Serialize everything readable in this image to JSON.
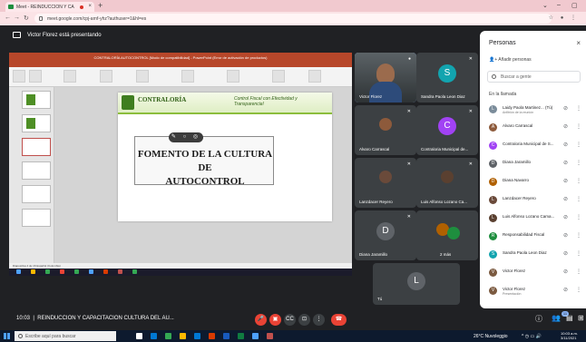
{
  "browser": {
    "tab_title": "Meet - REINDUCCION Y CA",
    "new_tab": "+",
    "url": "meet.google.com/cpj-arnf-yhz?authuser=1&hl=es",
    "win_min": "⌄",
    "win_max": "–",
    "win_close": "▢"
  },
  "presenting": {
    "text": "Victor Florez está presentando"
  },
  "powerpoint": {
    "title": "CONTRALORÍA AUTOCONTROL [Modo de compatibilidad] - PowerPoint (Error de activación de productos)",
    "status": "Diapositiva 4 de 16   Español (Colombia)",
    "slide": {
      "org": "CONTRALORÍA",
      "slogan": "Control Fiscal con Efectividad y Transparencia!",
      "headline_line1": "FOMENTO DE LA CULTURA DE",
      "headline_line2": "AUTOCONTROL"
    }
  },
  "tiles": [
    {
      "name": "Victor Florez",
      "type": "camera"
    },
    {
      "name": "Sandra Paola Leon Diaz",
      "type": "letter",
      "letter": "S",
      "color": "#12a4af"
    },
    {
      "name": "Alvaro Carrascal",
      "type": "photo"
    },
    {
      "name": "Contraloria Municipal de...",
      "type": "letter",
      "letter": "C",
      "color": "#a142f4"
    },
    {
      "name": "Lanzdacer Reyero",
      "type": "photo"
    },
    {
      "name": "Luis Alfonso Lozano Ca...",
      "type": "photo"
    },
    {
      "name": "Diana Jaramillo",
      "type": "letter",
      "letter": "D",
      "color": "#5f6368"
    },
    {
      "name": "2 más",
      "type": "photo"
    },
    {
      "name": "Tú",
      "type": "letter",
      "letter": "L",
      "color": "#5f6368"
    }
  ],
  "people_panel": {
    "title": "Personas",
    "add_people": "Añadir personas",
    "search_placeholder": "Buscar a gente",
    "section": "En la llamada",
    "rows": [
      {
        "name": "Laidy Paola Martinez... (Tú)",
        "sub": "Anfitrión de la reunión",
        "letter": "L",
        "color": "#7b8c9a"
      },
      {
        "name": "Alvaro Carrascal",
        "letter": "A",
        "color": "#8d5a3b"
      },
      {
        "name": "Contraloria Municipal de S...",
        "letter": "C",
        "color": "#a142f4"
      },
      {
        "name": "Diana Jaramillo",
        "letter": "D",
        "color": "#5f6368"
      },
      {
        "name": "Diana Navarro",
        "letter": "D",
        "color": "#b06000"
      },
      {
        "name": "Lanzdacer Reyero",
        "letter": "L",
        "color": "#6a4a3a"
      },
      {
        "name": "Luis Alfonso Lozano Cama...",
        "letter": "L",
        "color": "#5a4030"
      },
      {
        "name": "Responsabilidad Fiscal",
        "letter": "R",
        "color": "#1e8e3e"
      },
      {
        "name": "Sandra Paola Leon Diaz",
        "letter": "S",
        "color": "#12a4af"
      },
      {
        "name": "Victor Florez",
        "letter": "V",
        "color": "#7b5a40"
      },
      {
        "name": "Victor Florez",
        "sub": "Presentación",
        "letter": "V",
        "color": "#7b5a40"
      }
    ]
  },
  "bottom_bar": {
    "time": "10:03",
    "meeting_title": "REINDUCCION Y CAPACITACION CULTURA DEL AU...",
    "participants_badge": "11"
  },
  "taskbar": {
    "search_placeholder": "Escribe aquí para buscar",
    "weather": "26°C  Nuvoleggio",
    "time": "10:03 a.m.",
    "date": "3/11/2021"
  }
}
